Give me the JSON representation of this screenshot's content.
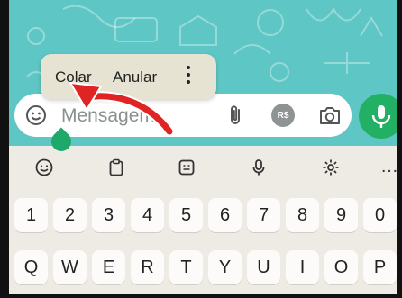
{
  "context_menu": {
    "paste_label": "Colar",
    "undo_label": "Anular",
    "more_icon": "vertical-dots-icon"
  },
  "input": {
    "placeholder": "Mensagem",
    "emoji_icon": "emoji-icon",
    "attach_icon": "paperclip-icon",
    "payment_label": "R$",
    "camera_icon": "camera-icon",
    "mic_icon": "mic-icon"
  },
  "keyboard": {
    "toolbar_icons": [
      "emoji-icon",
      "clipboard-icon",
      "sticker-icon",
      "mic-icon",
      "settings-icon"
    ],
    "toolbar_more": "…",
    "number_row": [
      "1",
      "2",
      "3",
      "4",
      "5",
      "6",
      "7",
      "8",
      "9",
      "0"
    ],
    "letter_row": [
      "Q",
      "W",
      "E",
      "R",
      "T",
      "Y",
      "U",
      "I",
      "O",
      "P"
    ]
  },
  "colors": {
    "wallpaper": "#5ec6c4",
    "accent_green": "#22b064",
    "menu_bg": "#e6e3d3",
    "arrow_red": "#e02424",
    "keyboard_bg": "#eeeae4"
  }
}
